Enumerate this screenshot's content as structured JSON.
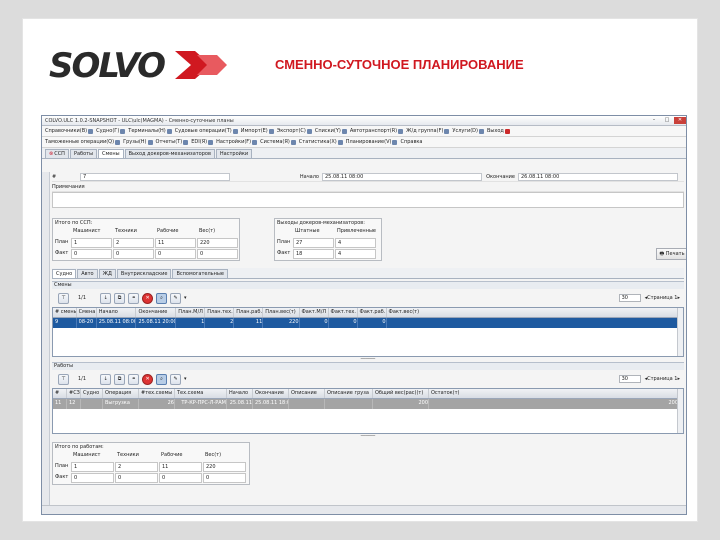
{
  "slide": {
    "title": "СМЕННО-СУТОЧНОЕ ПЛАНИРОВАНИЕ",
    "logo_text": "SOLVO",
    "brand_color": "#d01820"
  },
  "window": {
    "title": "COLVO.ULC 1.0.2-SNAPSHOT - ULC\\ulc(MAGMA) - Сменно-суточные планы",
    "min": "–",
    "max": "□",
    "close": "✕"
  },
  "menu1": [
    "Справочники(В)",
    "Судно(Г)",
    "Терминалы(Н)",
    "Судовые операции(Т)",
    "Импорт(Е)",
    "Экспорт(С)",
    "Списки(Y)",
    "Автотранспорт(R)",
    "Ж/д группа(F)",
    "Услуги(D)",
    "Выход"
  ],
  "menu2": [
    "Таможенные операции(Q)",
    "Грузы(Н)",
    "Отчеты(Т)",
    "EDI(Я)",
    "Настройки(F)",
    "Система(Я)",
    "Статистика(Х)",
    "Планирование(V)",
    "Справка"
  ],
  "tabs": [
    {
      "label": "ССП",
      "closable": true
    },
    {
      "label": "Работы"
    },
    {
      "label": "Смены",
      "active": true
    },
    {
      "label": "Выход докеров-механизаторов"
    },
    {
      "label": "Настройки"
    }
  ],
  "header": {
    "num_label": "#",
    "num_value": "7",
    "start_label": "Начало",
    "start_value": "25.08.11 08:00",
    "end_label": "Окончание",
    "end_value": "26.08.11 08:00",
    "note_label": "Примечания"
  },
  "ccp_totals": {
    "caption": "Итого по ССП:",
    "columns": [
      "Машинист",
      "Техники",
      "Рабочие",
      "Вес(т)"
    ],
    "rows": [
      {
        "label": "План",
        "values": [
          "1",
          "2",
          "11",
          "220"
        ]
      },
      {
        "label": "Факт",
        "values": [
          "0",
          "0",
          "0",
          "0"
        ]
      }
    ]
  },
  "dockers": {
    "caption": "Выходы докеров-механизаторов:",
    "columns": [
      "Штатные",
      "Привлеченные"
    ],
    "rows": [
      {
        "label": "План",
        "values": [
          "27",
          "4"
        ]
      },
      {
        "label": "Факт",
        "values": [
          "18",
          "4"
        ]
      }
    ]
  },
  "print_button": "Печать",
  "subtabs": [
    "Судно",
    "Авто",
    "ЖД",
    "Внутрискладские",
    "Вспомогательные"
  ],
  "shifts": {
    "title": "Смены",
    "count": "1/1",
    "page_size": "30",
    "page_label": "Страница 1",
    "columns": [
      "# смены",
      "Смена",
      "Начало",
      "Окончание",
      "План.М/Л",
      "План.тех.",
      "План.раб.",
      "План.вес(т)",
      "Факт.М/Л",
      "Факт.тех.",
      "Факт.раб.",
      "Факт.вес(т)"
    ],
    "rows": [
      [
        "9",
        "08-20",
        "25.08.11 08:00",
        "25.08.11 20:00",
        "1",
        "2",
        "11",
        "220",
        "0",
        "0",
        "0",
        "0"
      ]
    ]
  },
  "works": {
    "title": "Работы",
    "count": "1/1",
    "page_size": "30",
    "page_label": "Страница 1",
    "columns": [
      "#",
      "#СЗ",
      "Судно",
      "Операция",
      "#тех.схемы",
      "Тех.схема",
      "Начало",
      "Окончание",
      "Описание",
      "Описание груза",
      "Общий вес(рас)(т)",
      "Остаток(т)"
    ],
    "rows": [
      [
        "11",
        "12",
        "",
        "Выгрузка",
        "26",
        "ТР-КР-ПРС-Л-РАМ",
        "25.08.11",
        "25.08.11 18:0",
        "",
        "",
        "200",
        "200"
      ]
    ]
  },
  "work_totals": {
    "caption": "Итого по работам:",
    "columns": [
      "Машинист",
      "Техники",
      "Рабочие",
      "Вес(т)"
    ],
    "rows": [
      {
        "label": "План",
        "values": [
          "1",
          "2",
          "11",
          "220"
        ]
      },
      {
        "label": "Факт",
        "values": [
          "0",
          "0",
          "0",
          "0"
        ]
      }
    ]
  }
}
